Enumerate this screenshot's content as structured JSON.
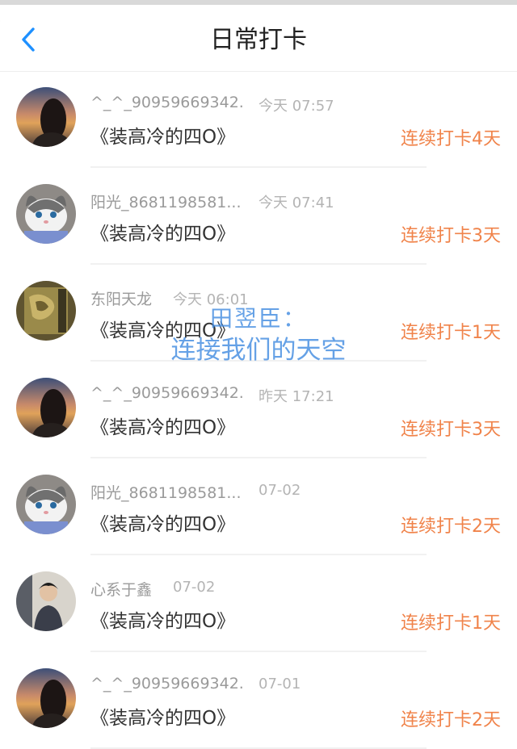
{
  "header": {
    "title": "日常打卡",
    "back_icon": "chevron-left-icon"
  },
  "colors": {
    "accent": "#f0834a",
    "back": "#1e90ff",
    "watermark": "#4a90e2"
  },
  "entries": [
    {
      "name": "^_^_90959669342...",
      "time": "今天 07:57",
      "topic": "《装高冷的四O》",
      "streak": "连续打卡4天",
      "avatar": "sunset-girl"
    },
    {
      "name": "阳光_8681198581...",
      "time": "今天 07:41",
      "topic": "《装高冷的四O》",
      "streak": "连续打卡3天",
      "avatar": "gray-cat"
    },
    {
      "name": "东阳天龙",
      "time": "今天 06:01",
      "topic": "《装高冷的四O》",
      "streak": "连续打卡1天",
      "avatar": "carving"
    },
    {
      "name": "^_^_90959669342...",
      "time": "昨天 17:21",
      "topic": "《装高冷的四O》",
      "streak": "连续打卡3天",
      "avatar": "sunset-girl"
    },
    {
      "name": "阳光_8681198581...",
      "time": "07-02",
      "topic": "《装高冷的四O》",
      "streak": "连续打卡2天",
      "avatar": "gray-cat"
    },
    {
      "name": "心系于鑫",
      "time": "07-02",
      "topic": "《装高冷的四O》",
      "streak": "连续打卡1天",
      "avatar": "young-man"
    },
    {
      "name": "^_^_90959669342...",
      "time": "07-01",
      "topic": "《装高冷的四O》",
      "streak": "连续打卡2天",
      "avatar": "sunset-girl"
    }
  ],
  "watermark": {
    "line1": "田翌臣：",
    "line2": "连接我们的天空"
  }
}
